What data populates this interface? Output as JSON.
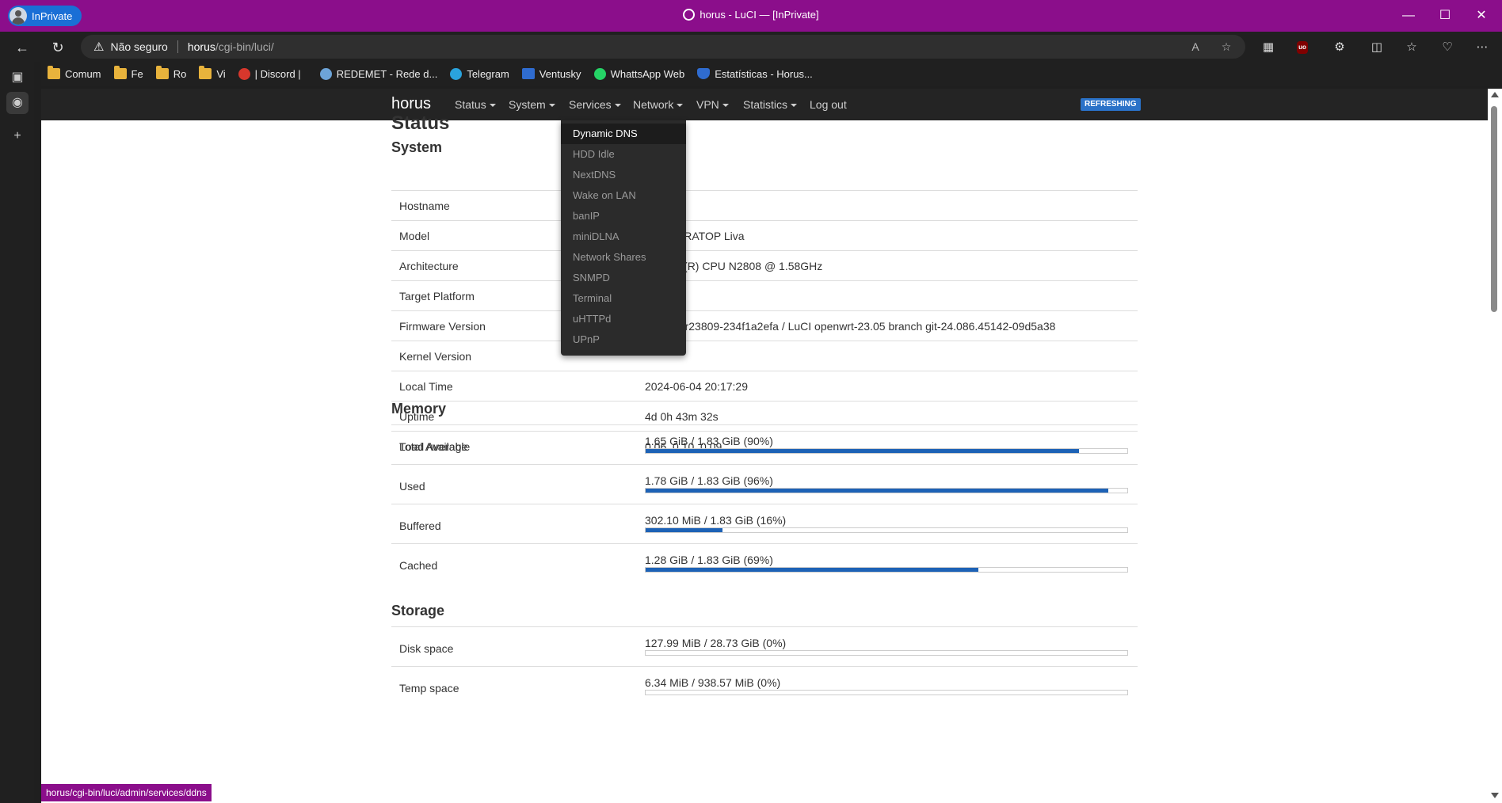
{
  "browser": {
    "inprivate_label": "InPrivate",
    "window_title": "horus - LuCI — [InPrivate]",
    "security_label": "Não seguro",
    "url_host": "horus",
    "url_path": "/cgi-bin/luci/",
    "status_link": "horus/cgi-bin/luci/admin/services/ddns"
  },
  "bookmarks": [
    {
      "label": "Comum",
      "icon": "folder-icon"
    },
    {
      "label": "Fe",
      "icon": "folder-icon"
    },
    {
      "label": "Ro",
      "icon": "folder-icon"
    },
    {
      "label": "Vi",
      "icon": "folder-icon"
    },
    {
      "label": "| Discord |",
      "icon": "discord-icon"
    },
    {
      "label": "REDEMET - Rede d...",
      "icon": "redemet-icon"
    },
    {
      "label": "Telegram",
      "icon": "telegram-icon"
    },
    {
      "label": "Ventusky",
      "icon": "ventusky-icon"
    },
    {
      "label": "WhattsApp Web",
      "icon": "whatsapp-icon"
    },
    {
      "label": "Estatísticas - Horus...",
      "icon": "shield-icon"
    }
  ],
  "luci": {
    "brand": "horus",
    "menu": [
      "Status",
      "System",
      "Services",
      "Network",
      "VPN",
      "Statistics"
    ],
    "logout": "Log out",
    "refreshing": "REFRESHING",
    "services_dropdown": [
      "Dynamic DNS",
      "HDD Idle",
      "NextDNS",
      "Wake on LAN",
      "banIP",
      "miniDLNA",
      "Network Shares",
      "SNMPD",
      "Terminal",
      "uHTTPd",
      "UPnP"
    ]
  },
  "page": {
    "title": "Status",
    "system_heading": "System",
    "system": [
      {
        "key": "Hostname",
        "value": ""
      },
      {
        "key": "Model",
        "value": "OP ULTRATOP Liva"
      },
      {
        "key": "Architecture",
        "value": "Celeron(R) CPU N2808 @ 1.58GHz"
      },
      {
        "key": "Target Platform",
        "value": ""
      },
      {
        "key": "Firmware Version",
        "value": "23.05.3 r23809-234f1a2efa / LuCI openwrt-23.05 branch git-24.086.45142-09d5a38"
      },
      {
        "key": "Kernel Version",
        "value": ""
      },
      {
        "key": "Local Time",
        "value": "2024-06-04 20:17:29"
      },
      {
        "key": "Uptime",
        "value": "4d 0h 43m 32s"
      },
      {
        "key": "Load Average",
        "value": "0.06, 0.10, 0.09"
      }
    ],
    "memory_heading": "Memory",
    "memory": [
      {
        "key": "Total Available",
        "value": "1.65 GiB / 1.83 GiB (90%)",
        "percent": 90
      },
      {
        "key": "Used",
        "value": "1.78 GiB / 1.83 GiB (96%)",
        "percent": 96
      },
      {
        "key": "Buffered",
        "value": "302.10 MiB / 1.83 GiB (16%)",
        "percent": 16
      },
      {
        "key": "Cached",
        "value": "1.28 GiB / 1.83 GiB (69%)",
        "percent": 69
      }
    ],
    "storage_heading": "Storage",
    "storage": [
      {
        "key": "Disk space",
        "value": "127.99 MiB / 28.73 GiB (0%)",
        "percent": 0
      },
      {
        "key": "Temp space",
        "value": "6.34 MiB / 938.57 MiB (0%)",
        "percent": 0
      }
    ]
  },
  "colors": {
    "titlebar": "#8b0e8b",
    "accent": "#1d62b6",
    "luci_header": "#242424"
  }
}
